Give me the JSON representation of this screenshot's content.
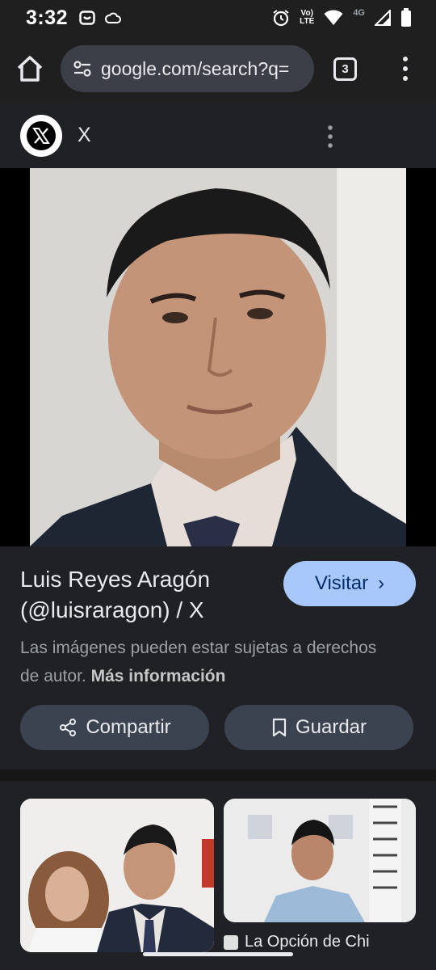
{
  "status_bar": {
    "time": "3:32",
    "network_label_top": "Vo)",
    "network_label_bottom": "LTE",
    "signal_type": "4G",
    "icons": [
      "notification-icon",
      "cloud-icon",
      "alarm-icon",
      "wifi-icon",
      "signal-icon",
      "battery-icon"
    ]
  },
  "browser": {
    "url": "google.com/search?q=",
    "tab_count": "3"
  },
  "source": {
    "name": "X",
    "logo_letter": "𝕏"
  },
  "result": {
    "title": "Luis Reyes Aragón (@luisraragon) / X",
    "visit_label": "Visitar",
    "visit_chevron": "›",
    "notice_text": "Las imágenes pueden estar sujetas a derechos de autor. ",
    "notice_link": "Más información",
    "share_label": "Compartir",
    "save_label": "Guardar"
  },
  "related": {
    "item2_caption": "La Opción de Chi"
  },
  "colors": {
    "background": "#202124",
    "visit_button": "#a8c7fa",
    "pill_button": "#3c4350",
    "url_pill": "#3c3f47"
  }
}
